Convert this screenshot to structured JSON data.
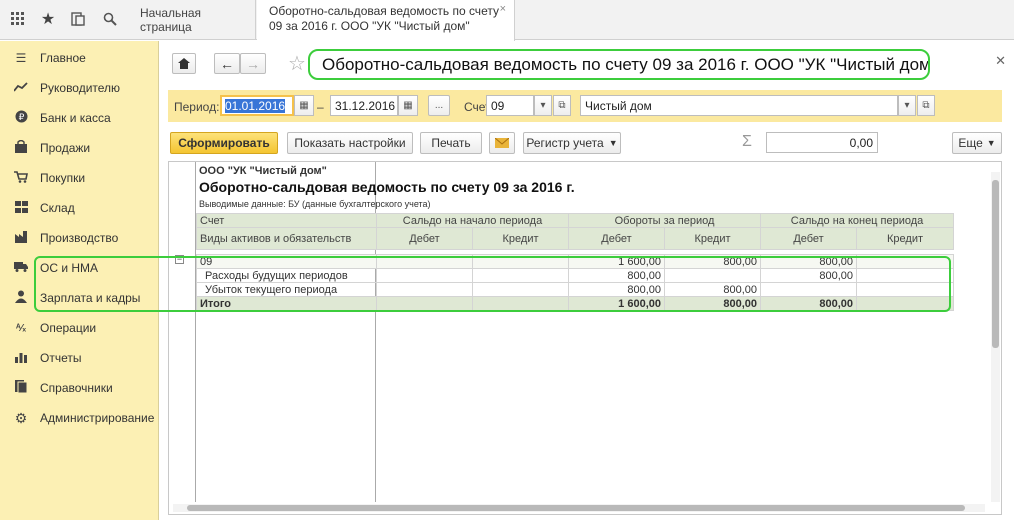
{
  "topbar": {
    "icons": [
      "apps-icon",
      "star-icon",
      "history-icon",
      "search-icon"
    ],
    "tabs": [
      {
        "label": "Начальная страница"
      },
      {
        "label_line1": "Оборотно-сальдовая ведомость по счету",
        "label_line2": "09 за 2016 г. ООО \"УК \"Чистый дом\""
      }
    ]
  },
  "sidebar": {
    "items": [
      {
        "label": "Главное",
        "icon": "menu-icon"
      },
      {
        "label": "Руководителю",
        "icon": "trend-icon"
      },
      {
        "label": "Банк и касса",
        "icon": "ruble-icon"
      },
      {
        "label": "Продажи",
        "icon": "bag-icon"
      },
      {
        "label": "Покупки",
        "icon": "cart-icon"
      },
      {
        "label": "Склад",
        "icon": "grid-icon"
      },
      {
        "label": "Производство",
        "icon": "factory-icon"
      },
      {
        "label": "ОС и НМА",
        "icon": "truck-icon"
      },
      {
        "label": "Зарплата и кадры",
        "icon": "person-icon"
      },
      {
        "label": "Операции",
        "icon": "ops-icon"
      },
      {
        "label": "Отчеты",
        "icon": "chart-icon"
      },
      {
        "label": "Справочники",
        "icon": "book-icon"
      },
      {
        "label": "Администрирование",
        "icon": "gear-icon"
      }
    ]
  },
  "header": {
    "title": "Оборотно-сальдовая ведомость по счету 09 за 2016 г. ООО \"УК \"Чистый дом\""
  },
  "params": {
    "period_label": "Период:",
    "date_from": "01.01.2016",
    "dash": "–",
    "date_to": "31.12.2016",
    "dots": "...",
    "account_label": "Счет:",
    "account": "09",
    "org": "Чистый дом"
  },
  "toolbar": {
    "generate": "Сформировать",
    "settings": "Показать настройки",
    "print": "Печать",
    "register": "Регистр учета",
    "sum_value": "0,00",
    "more": "Еще"
  },
  "report": {
    "org": "ООО \"УК \"Чистый дом\"",
    "title": "Оборотно-сальдовая ведомость по счету 09 за 2016 г.",
    "data_shown": "Выводимые данные:  БУ (данные бухгалтерского учета)",
    "headers": {
      "account": "Счет",
      "kinds": "Виды активов и обязательств",
      "start": "Сальдо на начало периода",
      "turnover": "Обороты за период",
      "end": "Сальдо на конец периода",
      "debit": "Дебет",
      "credit": "Кредит"
    },
    "rows": [
      {
        "name": "09",
        "sd": "",
        "sc": "",
        "td": "1 600,00",
        "tc": "800,00",
        "ed": "800,00",
        "ec": ""
      },
      {
        "name": "Расходы будущих периодов",
        "sd": "",
        "sc": "",
        "td": "800,00",
        "tc": "",
        "ed": "800,00",
        "ec": ""
      },
      {
        "name": "Убыток текущего периода",
        "sd": "",
        "sc": "",
        "td": "800,00",
        "tc": "800,00",
        "ed": "",
        "ec": ""
      },
      {
        "name": "Итого",
        "sd": "",
        "sc": "",
        "td": "1 600,00",
        "tc": "800,00",
        "ed": "800,00",
        "ec": ""
      }
    ]
  }
}
